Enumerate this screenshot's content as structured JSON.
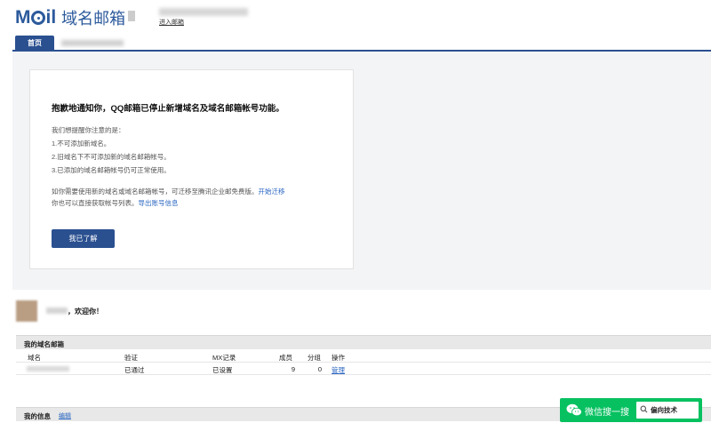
{
  "app": {
    "logo_brand": "Mail",
    "logo_title": "域名邮箱",
    "enter_mailbox": "进入邮箱"
  },
  "tabs": [
    {
      "label": "首页",
      "active": true
    }
  ],
  "notice": {
    "title": "抱歉地通知你，QQ邮箱已停止新增域名及域名邮箱帐号功能。",
    "intro": "我们想提醒你注意的是：",
    "items": [
      "1.不可添加新域名。",
      "2.旧域名下不可添加新的域名邮箱帐号。",
      "3.已添加的域名邮箱帐号仍可正常使用。"
    ],
    "migrate_text": "如你需要使用新的域名或域名邮箱帐号，可迁移至腾讯企业邮免费版。",
    "migrate_link": "开始迁移",
    "export_text": "你也可以直接获取帐号列表。",
    "export_link": "导出账号信息",
    "ok_button": "我已了解"
  },
  "welcome": {
    "text": "，欢迎你！"
  },
  "domains": {
    "section_title": "我的域名邮箱",
    "columns": [
      "域名",
      "验证",
      "MX记录",
      "成员",
      "分组",
      "操作"
    ],
    "rows": [
      {
        "verify": "已通过",
        "mx": "已设置",
        "members": "9",
        "groups": "0",
        "action": "管理"
      }
    ]
  },
  "my_info": {
    "section_title": "我的信息",
    "edit_link": "编辑"
  },
  "watermark": {
    "text": "微信搜一搜",
    "search_text": "偏向技术",
    "brand_color": "#07c160"
  },
  "colors": {
    "accent": "#2a5090",
    "link": "#2a66c2"
  }
}
